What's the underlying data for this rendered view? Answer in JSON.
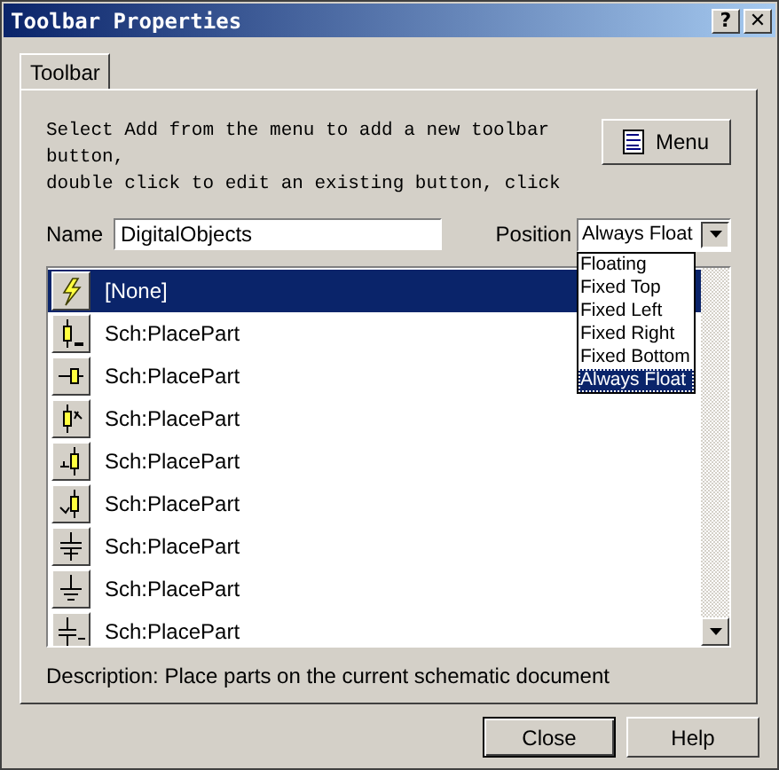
{
  "window": {
    "title": "Toolbar Properties",
    "help_button": "?",
    "close_button": "✕"
  },
  "tabs": [
    {
      "label": "Toolbar",
      "selected": true
    }
  ],
  "instructions": [
    "Select Add from the menu to add a new toolbar",
    "button,",
    "double click to edit an existing button, click"
  ],
  "menu_button": "Menu",
  "name_field": {
    "label": "Name",
    "value": "DigitalObjects"
  },
  "position": {
    "label": "Position",
    "value": "Always Float",
    "expanded": true,
    "options": [
      {
        "label": "Floating",
        "selected": false
      },
      {
        "label": "Fixed Top",
        "selected": false
      },
      {
        "label": "Fixed Left",
        "selected": false
      },
      {
        "label": "Fixed Right",
        "selected": false
      },
      {
        "label": "Fixed Bottom",
        "selected": false
      },
      {
        "label": "Always Float",
        "selected": true
      }
    ]
  },
  "buttons_list": [
    {
      "label": "[None]",
      "selected": true
    },
    {
      "label": "Sch:PlacePart",
      "selected": false
    },
    {
      "label": "Sch:PlacePart",
      "selected": false
    },
    {
      "label": "Sch:PlacePart",
      "selected": false
    },
    {
      "label": "Sch:PlacePart",
      "selected": false
    },
    {
      "label": "Sch:PlacePart",
      "selected": false
    },
    {
      "label": "Sch:PlacePart",
      "selected": false
    },
    {
      "label": "Sch:PlacePart",
      "selected": false
    },
    {
      "label": "Sch:PlacePart",
      "selected": false
    }
  ],
  "description": "Description: Place parts on the current schematic document",
  "footer_buttons": [
    {
      "label": "Close",
      "default": true
    },
    {
      "label": "Help",
      "default": false
    }
  ]
}
